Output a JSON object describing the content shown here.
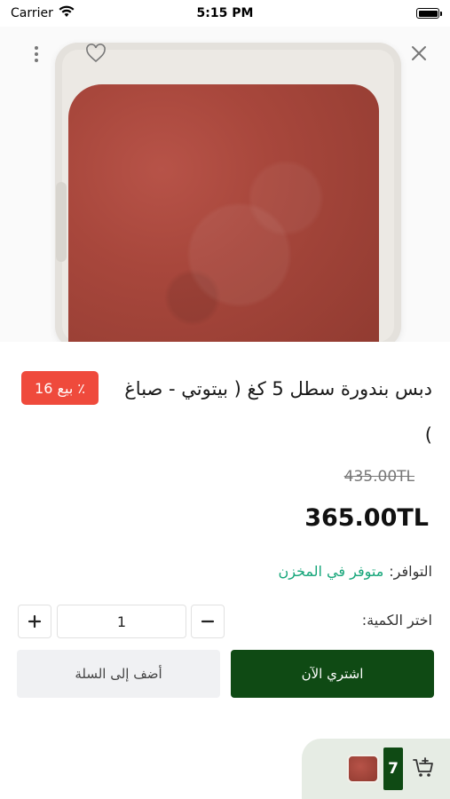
{
  "status_bar": {
    "carrier": "Carrier",
    "time": "5:15 PM"
  },
  "product": {
    "sale_badge": "بيع 16 ٪",
    "title": "دبس بندورة سطل 5 كغ ( بيتوتي - صباغ )",
    "old_price": "435.00TL",
    "price": "365.00TL",
    "availability_label": "التوافر:",
    "availability_value": "متوفر في المخزن"
  },
  "quantity": {
    "label": "اختر الكمية:",
    "value": "1"
  },
  "actions": {
    "buy_now": "اشتري الآن",
    "add_to_cart": "أضف إلى السلة"
  },
  "mini_cart": {
    "count": "7"
  },
  "icons": {
    "more": "more-vertical-icon",
    "favorite": "heart-icon",
    "close": "close-icon",
    "plus": "plus-icon",
    "minus": "minus-icon",
    "cart": "cart-add-icon",
    "wifi": "wifi-icon",
    "battery": "battery-icon"
  },
  "colors": {
    "primary_green": "#0f4a14",
    "sale_red": "#ef4a3c",
    "availability_green": "#16a67a",
    "secondary_button_bg": "#f0f1f3"
  }
}
